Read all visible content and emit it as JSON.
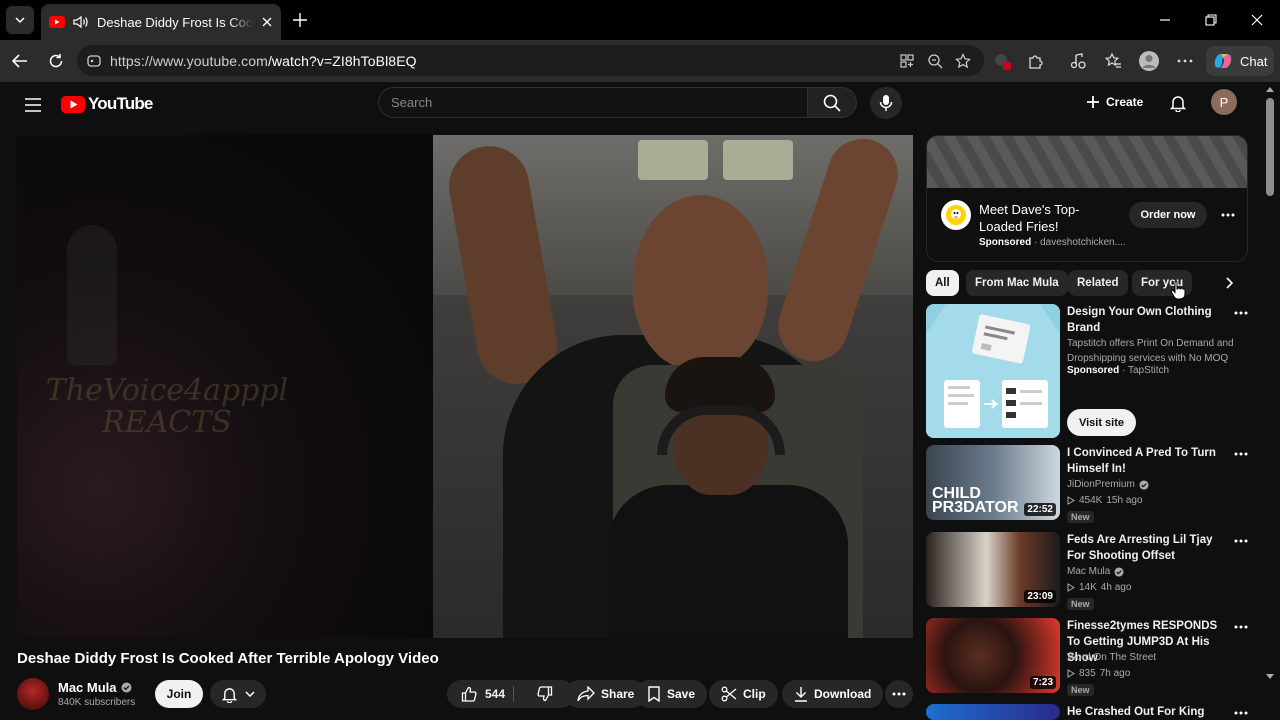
{
  "browser": {
    "tab_title": "Deshae Diddy Frost Is Cooked After Terrible Apology Video",
    "url_host": "https://www.youtube.com",
    "url_path": "/watch?v=ZI8hToBl8EQ",
    "chat_label": "Chat"
  },
  "header": {
    "logo_text": "YouTube",
    "search_placeholder": "Search",
    "create_label": "Create",
    "avatar_initial": "P"
  },
  "player": {
    "watermark": "TheVoice4apppl REACTS"
  },
  "video": {
    "title": "Deshae Diddy Frost Is Cooked After Terrible Apology Video",
    "channel": "Mac Mula",
    "subscribers": "840K subscribers",
    "join_label": "Join",
    "likes": "544",
    "share_label": "Share",
    "save_label": "Save",
    "clip_label": "Clip",
    "download_label": "Download"
  },
  "ad": {
    "title": "Meet Dave's Top-Loaded Fries!",
    "sponsored": "Sponsored",
    "advertiser": "· daveshotchicken....",
    "cta": "Order now"
  },
  "chips": [
    "All",
    "From Mac Mula",
    "Related",
    "For you"
  ],
  "sponsored_rec": {
    "title": "Design Your Own Clothing Brand",
    "description": "Tapstitch offers Print On Demand and Dropshipping services with No MOQ",
    "sponsored": "Sponsored",
    "advertiser": "· TapStitch",
    "cta": "Visit site"
  },
  "recommendations": [
    {
      "title": "I Convinced A Pred To Turn Himself In!",
      "channel": "JiDionPremium",
      "verified": true,
      "views": "454K",
      "age": "15h ago",
      "duration": "22:52",
      "badge": "New",
      "thumb_text": "CHILD PR3DATOR"
    },
    {
      "title": "Feds Are Arresting Lil Tjay For Shooting Offset",
      "channel": "Mac Mula",
      "verified": true,
      "views": "14K",
      "age": "4h ago",
      "duration": "23:09",
      "badge": "New"
    },
    {
      "title": "Finesse2tymes RESPONDS To Getting JUMP3D At His Show",
      "channel": "Word On The Street",
      "verified": false,
      "views": "835",
      "age": "7h ago",
      "duration": "7:23",
      "badge": "New"
    },
    {
      "title": "He Crashed Out For King Von:",
      "channel": "",
      "verified": false,
      "views": "",
      "age": "",
      "duration": "",
      "badge": ""
    }
  ],
  "colors": {
    "background": "#0f0f0f",
    "youtube_red": "#ff0000",
    "chip_active": "#f1f1f1",
    "chip": "#272727"
  }
}
